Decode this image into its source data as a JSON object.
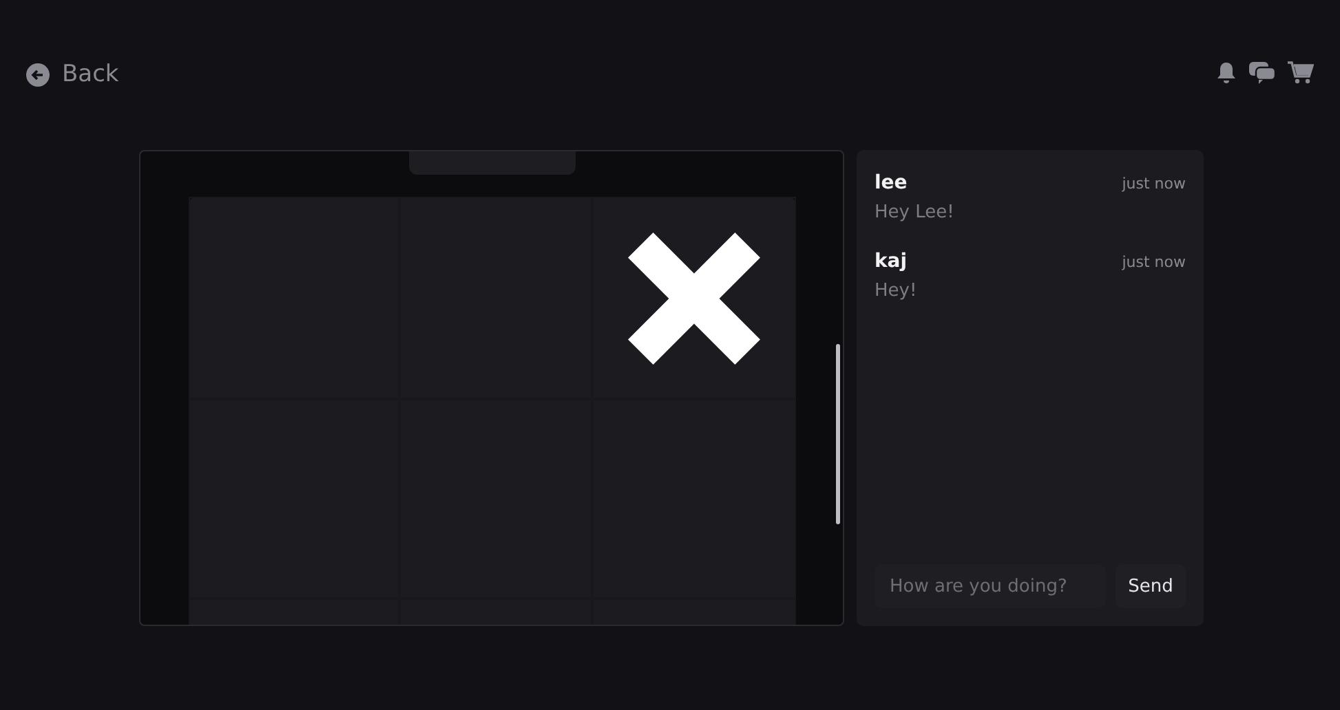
{
  "back": {
    "label": "Back"
  },
  "chat": {
    "messages": [
      {
        "author": "lee",
        "time": "just now",
        "text": "Hey Lee!"
      },
      {
        "author": "kaj",
        "time": "just now",
        "text": "Hey!"
      }
    ],
    "input": {
      "placeholder": "How are you doing?"
    },
    "send": "Send"
  }
}
